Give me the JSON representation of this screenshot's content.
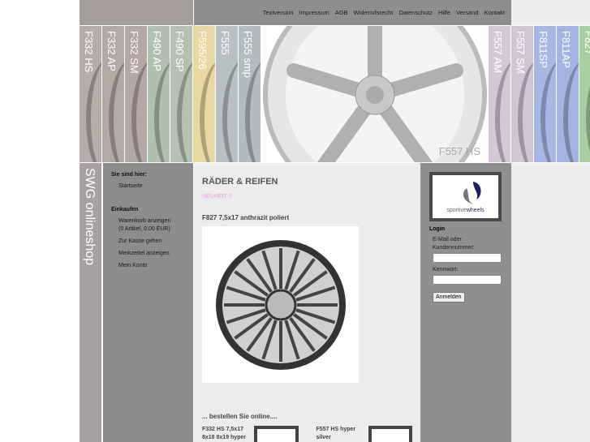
{
  "header": {
    "links": [
      "Textversion",
      "Impressum",
      "AGB",
      "Widerrufsrecht",
      "Datenschutz",
      "Hilfe",
      "Versand",
      "Kontakt"
    ]
  },
  "banner": {
    "strips": [
      {
        "label": "F332 HS",
        "color": "#b8aca8"
      },
      {
        "label": "F332 AP",
        "color": "#b5a9a5"
      },
      {
        "label": "F332 SM",
        "color": "#b3a8a6"
      },
      {
        "label": "F490 AP",
        "color": "#b2c0b0"
      },
      {
        "label": "F490 SP",
        "color": "#b4c2b3"
      },
      {
        "label": "F595/26",
        "color": "#e8d8a2"
      },
      {
        "label": "F555",
        "color": "#b8c0c4"
      },
      {
        "label": "F555 smp",
        "color": "#b3bcc0"
      }
    ],
    "right_strips": [
      {
        "label": "F557 AM",
        "color": "#d4c8d8"
      },
      {
        "label": "F557 SM",
        "color": "#d2c6d4"
      },
      {
        "label": "F811SP",
        "color": "#a8b8e4"
      },
      {
        "label": "F811AP",
        "color": "#a3b4e2"
      },
      {
        "label": "F827",
        "color": "#a8d0a0"
      }
    ],
    "hero_label": "F557 HS"
  },
  "sidebar": {
    "title": "SWG onlineshop",
    "here_heading": "Sie sind hier:",
    "here_items": [
      "Startseite"
    ],
    "shop_heading": "Einkaufen",
    "cart": "Warenkorb anzeigen",
    "cart_info": "(0 Artikel, 0,00 EUR)",
    "items": [
      "Zur Kasse gehen",
      "Merkzettel anzeigen",
      "Mein Konto"
    ]
  },
  "content": {
    "title": "RÄDER & REIFEN",
    "badge": "NEUHEIT !!",
    "product": "F827 7,5x17 anthrazit poliert",
    "order_heading": "... bestellen Sie online....",
    "thumbs": [
      "F332 HS 7,5x17 8x18 8x19 hyper",
      "F557 HS hyper silver"
    ]
  },
  "login": {
    "logo_a": "sportive",
    "logo_b": "wheels",
    "heading": "Login",
    "email_label": "E-Mail oder Kundennummer:",
    "email_value": "",
    "password_label": "Kennwort:",
    "password_value": "",
    "submit": "Anmelden"
  }
}
